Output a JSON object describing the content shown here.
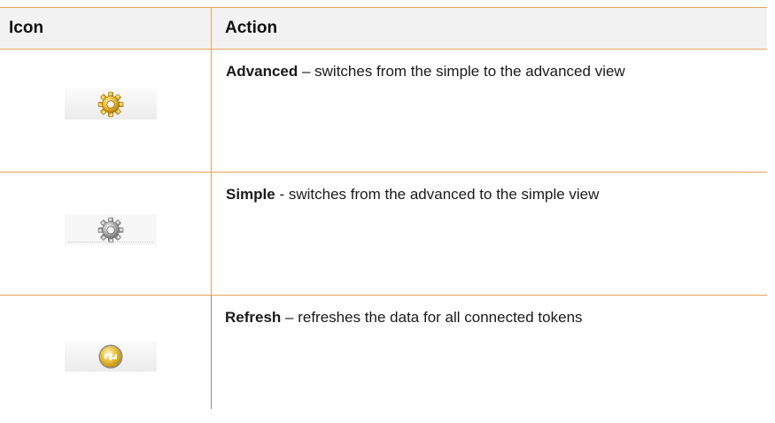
{
  "table": {
    "header": {
      "icon_label": "Icon",
      "action_label": "Action"
    },
    "rows": [
      {
        "icon": "gear-gold-icon",
        "name": "Advanced",
        "description": " – switches from the simple to the advanced view"
      },
      {
        "icon": "gear-gray-icon",
        "name": "Simple",
        "description": " - switches from the advanced to the simple view"
      },
      {
        "icon": "refresh-icon",
        "name": "Refresh",
        "description": " – refreshes the data for all connected tokens"
      }
    ]
  },
  "colors": {
    "border": "#e8a25a",
    "header_bg": "#f2f2f2",
    "gear_gold": "#d9a21b",
    "gear_gray": "#9a9a9a",
    "refresh_gold": "#e3b62c"
  }
}
